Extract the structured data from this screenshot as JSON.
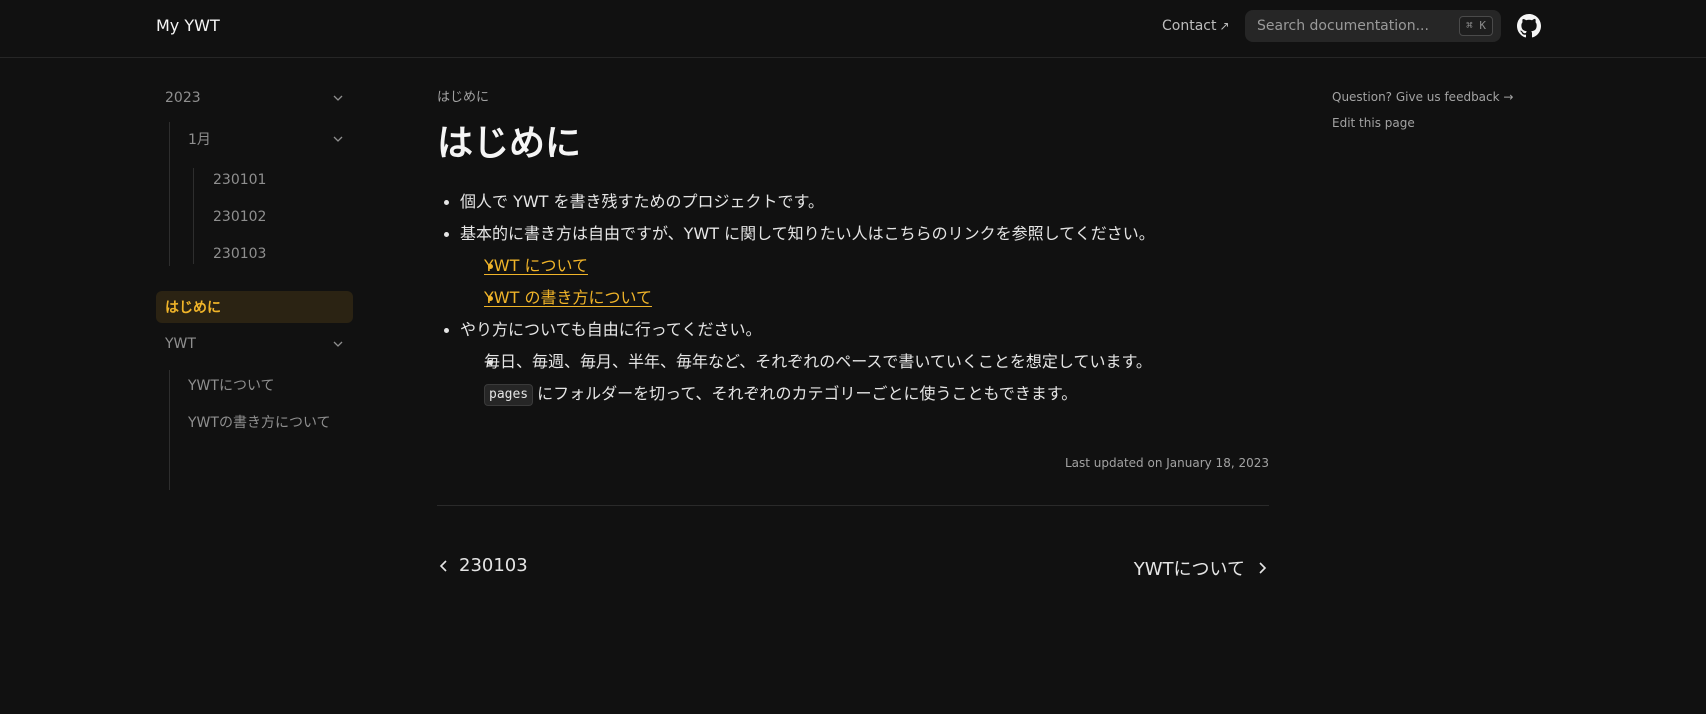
{
  "header": {
    "logo": "My YWT",
    "contact_label": "Contact",
    "contact_arrow": "↗",
    "search_placeholder": "Search documentation...",
    "search_shortcut": "⌘ K",
    "github_icon": "github-icon"
  },
  "sidebar": {
    "year_group": {
      "label": "2023"
    },
    "month_group": {
      "label": "1月"
    },
    "days": [
      "230101",
      "230102",
      "230103"
    ],
    "active": {
      "label": "はじめに"
    },
    "ywt_group": {
      "label": "YWT"
    },
    "ywt_items": [
      "YWTについて",
      "YWTの書き方について"
    ]
  },
  "main": {
    "breadcrumb": "はじめに",
    "title": "はじめに",
    "items": {
      "b1": "個人で YWT を書き残すためのプロジェクトです。",
      "b2": "基本的に書き方は自由ですが、YWT に関して知りたい人はこちらのリンクを参照してください。",
      "b2_links": [
        "YWT について",
        "YWT の書き方について"
      ],
      "b3": "やり方についても自由に行ってください。",
      "b3_sub1": "毎日、毎週、毎月、半年、毎年など、それぞれのペースで書いていくことを想定しています。",
      "b3_sub2_code": "pages",
      "b3_sub2_text": "にフォルダーを切って、それぞれのカテゴリーごとに使うこともできます。"
    },
    "last_updated": "Last updated on January 18, 2023",
    "prev_label": "230103",
    "next_label": "YWTについて"
  },
  "toc": {
    "feedback": "Question? Give us feedback →",
    "edit": "Edit this page"
  },
  "colors": {
    "accent": "#f0b429",
    "background": "#111111"
  }
}
